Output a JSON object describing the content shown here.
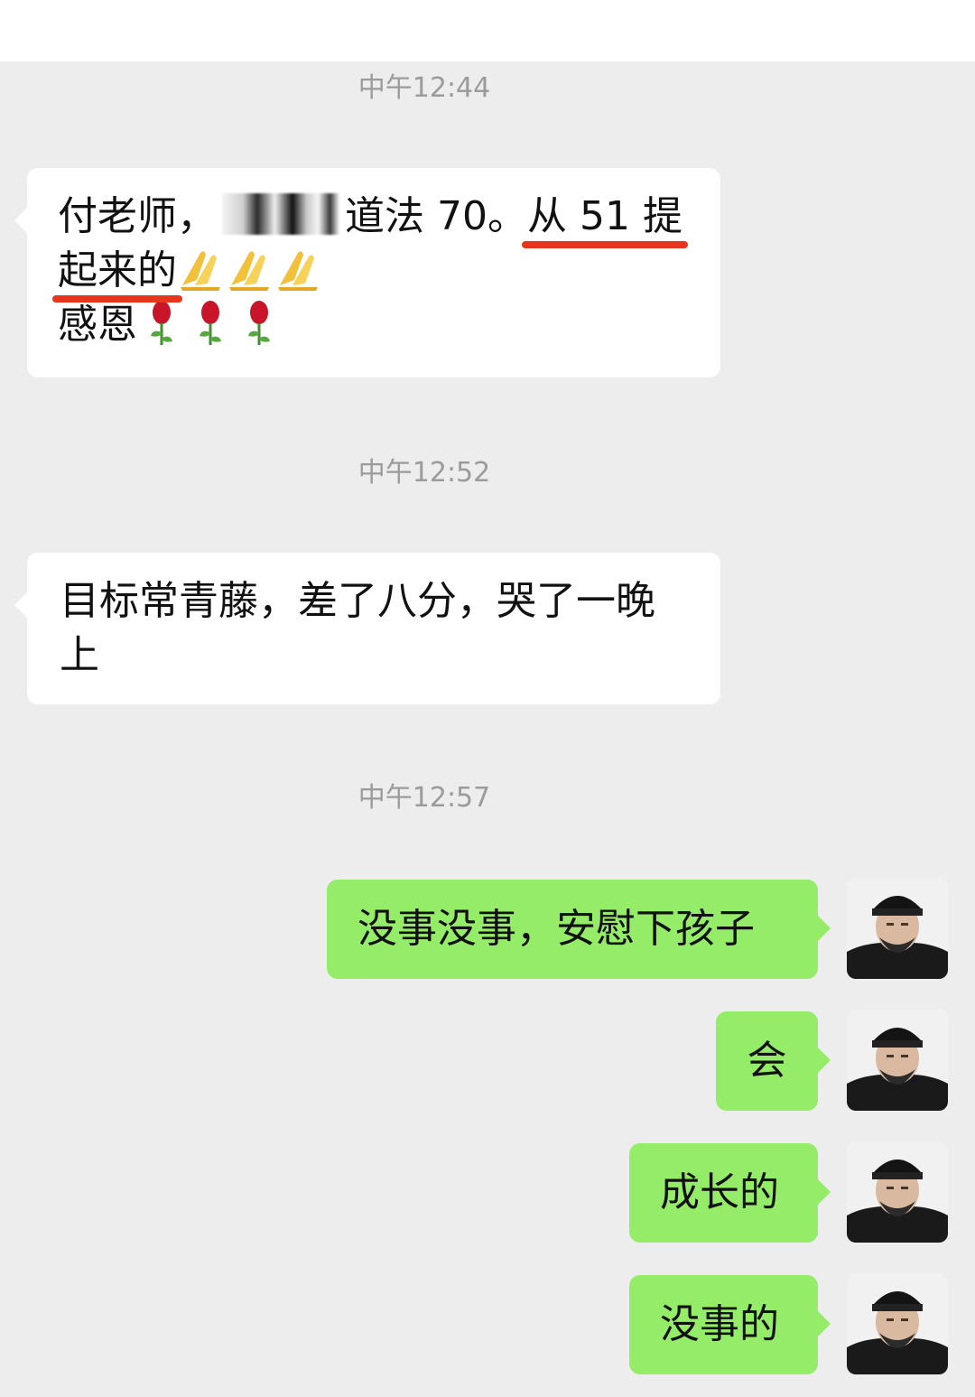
{
  "messages": [
    {
      "time": "中午12:44",
      "text": {
        "line1_prefix": "付老师，",
        "line1_mid": "道法 70。",
        "line1_highlight": "从 51 提",
        "line2_highlight": "起来的",
        "line3": "感恩"
      },
      "emoji": [
        "pray-hands",
        "pray-hands",
        "pray-hands",
        "rose",
        "rose",
        "rose"
      ]
    },
    {
      "time": "中午12:52",
      "lines": [
        "目标常青藤，差了八分，哭了一晚",
        "上"
      ]
    },
    {
      "time": "中午12:57",
      "replies": [
        "没事没事，安慰下孩子",
        "会",
        "成长的",
        "没事的"
      ]
    }
  ],
  "colors": {
    "background": "#ededed",
    "incoming_bubble": "#ffffff",
    "outgoing_bubble": "#95ec69",
    "timestamp": "#9b9b9b",
    "underline": "#e8361e"
  }
}
